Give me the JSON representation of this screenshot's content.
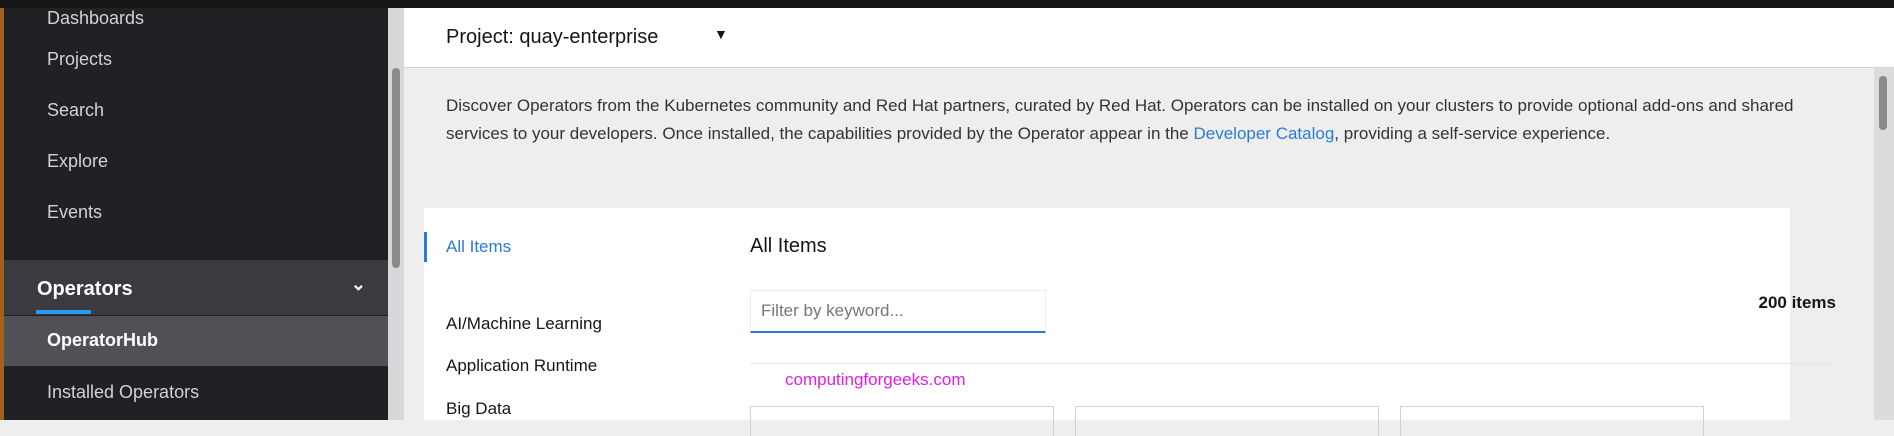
{
  "sidebar": {
    "items": [
      "Dashboards",
      "Projects",
      "Search",
      "Explore",
      "Events"
    ],
    "section": {
      "label": "Operators",
      "items": [
        "OperatorHub",
        "Installed Operators"
      ]
    }
  },
  "header": {
    "project": "Project: quay-enterprise"
  },
  "description": {
    "before": "Discover Operators from the Kubernetes community and Red Hat partners, curated by Red Hat. Operators can be installed on your clusters to provide optional add-ons and shared services to your developers. Once installed, the capabilities provided by the Operator appear in the ",
    "link": "Developer Catalog",
    "after": ", providing a self-service experience."
  },
  "catalog": {
    "categories": [
      "All Items",
      "AI/Machine Learning",
      "Application Runtime",
      "Big Data"
    ],
    "title": "All Items",
    "filter_placeholder": "Filter by keyword...",
    "count": "200 items"
  },
  "watermark": "computingforgeeks.com",
  "colors": {
    "accent": "#2b7bd6",
    "sidebar": "#1f2125"
  }
}
